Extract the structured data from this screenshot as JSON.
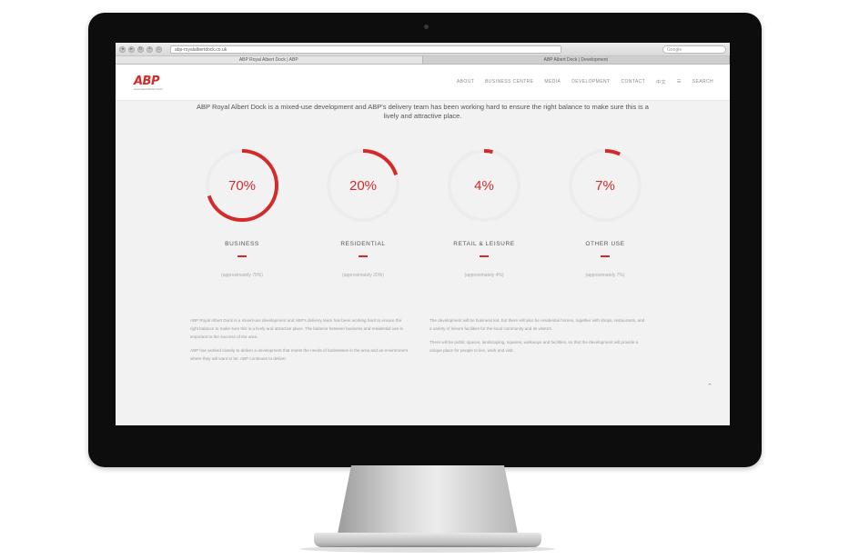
{
  "browser": {
    "nav_buttons": [
      "◂",
      "▸",
      "↻",
      "+",
      "⌂"
    ],
    "url": "abp-royalalbertdock.co.uk",
    "search_placeholder": "Google",
    "tabs": [
      "ABP Royal Albert Dock | ABP",
      "ABP Albert Dock | Development"
    ]
  },
  "site": {
    "logo": "ABP",
    "logo_sub": "Associated British Ports",
    "nav": [
      "ABOUT",
      "BUSINESS CENTRE",
      "MEDIA",
      "DEVELOPMENT",
      "CONTACT",
      "中文",
      "☰",
      "SEARCH"
    ],
    "intro": "ABP Royal Albert Dock is a mixed-use development and ABP's delivery team has been working hard to ensure the right balance to make sure this is a lively and attractive place."
  },
  "stats": [
    {
      "value": "70%",
      "percent": 70,
      "label": "BUSINESS",
      "sub": "(approximately 70%)"
    },
    {
      "value": "20%",
      "percent": 20,
      "label": "RESIDENTIAL",
      "sub": "(approximately 20%)"
    },
    {
      "value": "4%",
      "percent": 4,
      "label": "RETAIL & LEISURE",
      "sub": "(approximately 4%)"
    },
    {
      "value": "7%",
      "percent": 7,
      "label": "OTHER USE",
      "sub": "(approximately 7%)"
    }
  ],
  "body": {
    "left": [
      "ABP Royal Albert Dock is a mixed-use development and ABP's delivery team has been working hard to ensure the right balance to make sure this is a lively and attractive place. The balance between business and residential use is important to the success of the area.",
      "ABP has worked closely to deliver a development that meets the needs of businesses in the area and an environment where they will want to be. ABP continues to deliver."
    ],
    "right": [
      "The development will be business led, but there will also be residential homes, together with shops, restaurants, and a variety of leisure facilities for the local community and its visitors.",
      "There will be public spaces, landscaping, squares, walkways and facilities, so that the development will provide a unique place for people to live, work and visit."
    ],
    "scroll_icon": "⌃"
  },
  "colors": {
    "accent": "#d42a2a",
    "track": "#ececec"
  }
}
